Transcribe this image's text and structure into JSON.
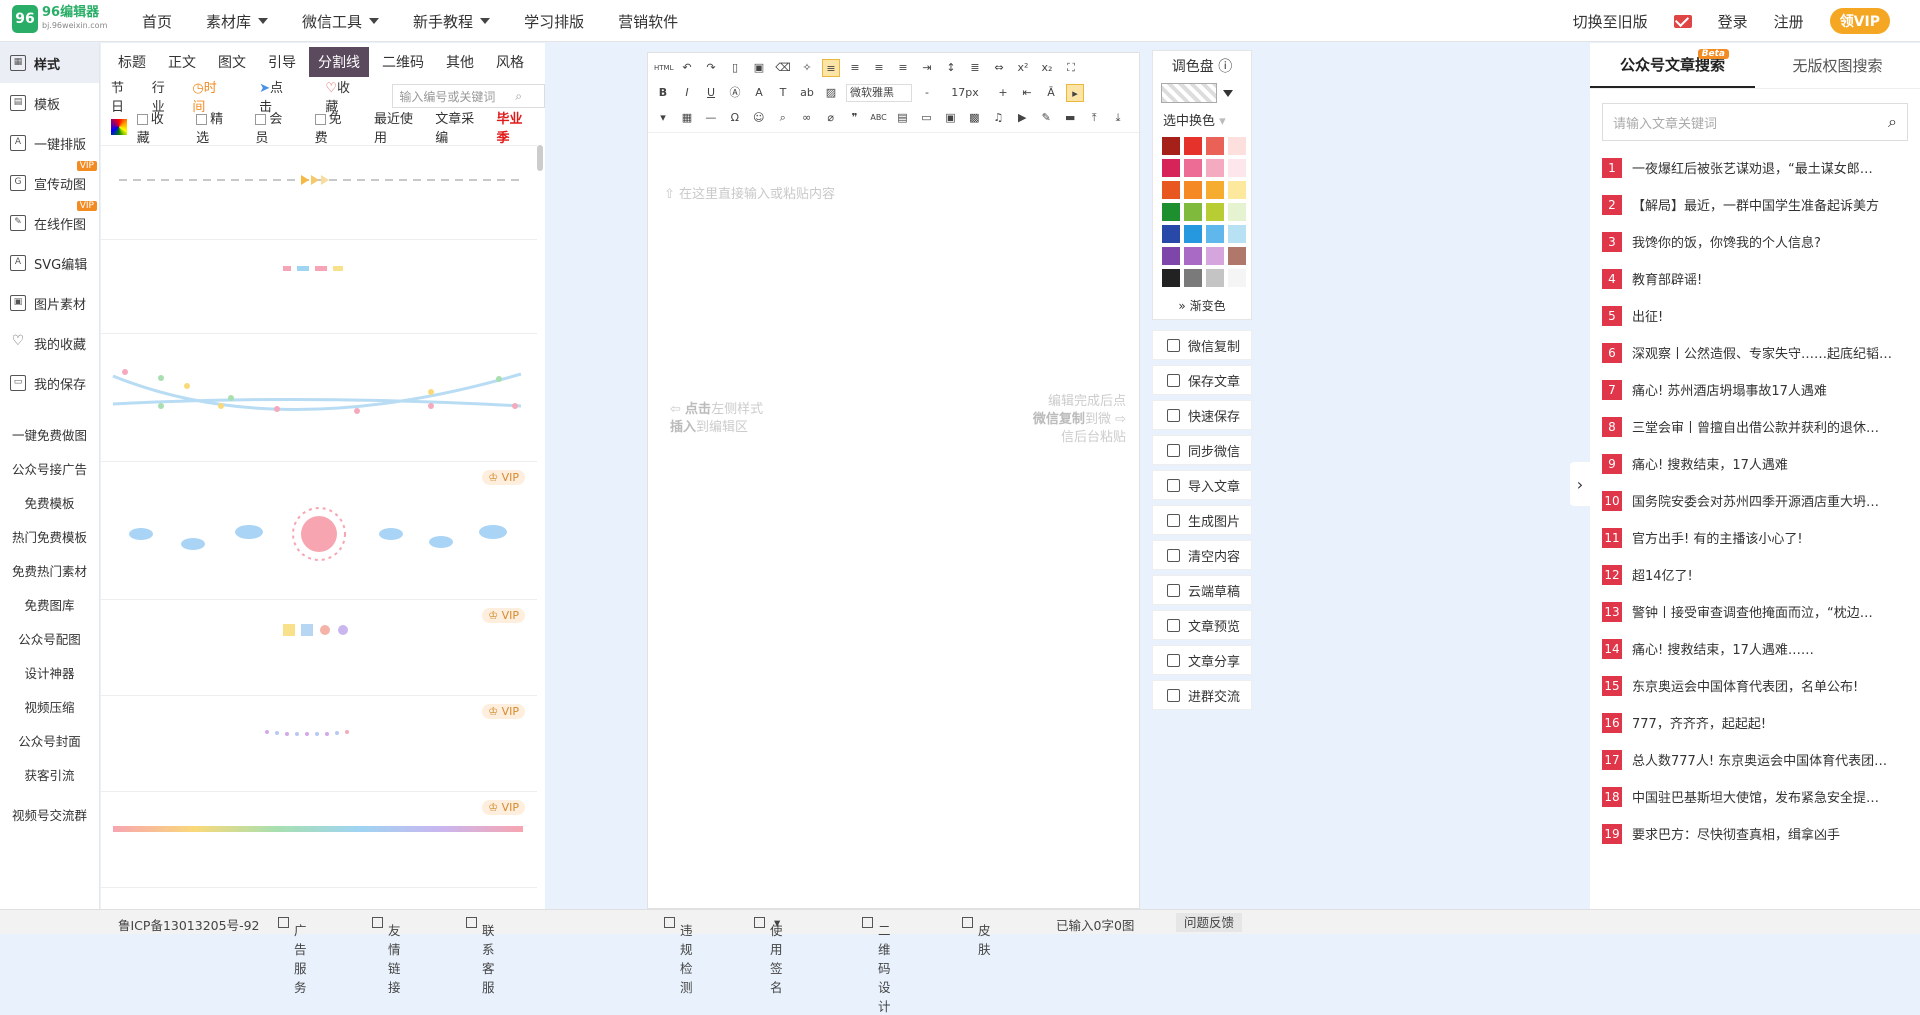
{
  "brand": {
    "logo_mark": "96",
    "name": "96编辑器",
    "domain": "bj.96weixin.com"
  },
  "nav": {
    "items": [
      "首页",
      "素材库",
      "微信工具",
      "新手教程",
      "学习排版",
      "营销软件"
    ]
  },
  "top_right": {
    "old_version": "切换至旧版",
    "login": "登录",
    "register": "注册",
    "vip": "领VIP"
  },
  "left_nav": {
    "items": [
      {
        "label": "样式",
        "icon": "style-icon"
      },
      {
        "label": "模板",
        "icon": "template-icon"
      },
      {
        "label": "一键排版",
        "icon": "auto-layout-icon"
      },
      {
        "label": "宣传动图",
        "icon": "gif-icon",
        "badge": "VIP"
      },
      {
        "label": "在线作图",
        "icon": "draw-icon",
        "badge": "VIP"
      },
      {
        "label": "SVG编辑",
        "icon": "svg-icon"
      },
      {
        "label": "图片素材",
        "icon": "image-icon"
      },
      {
        "label": "我的收藏",
        "icon": "heart-icon"
      },
      {
        "label": "我的保存",
        "icon": "save-icon"
      }
    ],
    "links": [
      "一键免费做图",
      "公众号接广告",
      "免费模板",
      "热门免费模板",
      "免费热门素材",
      "免费图库",
      "公众号配图",
      "设计神器",
      "视频压缩",
      "公众号封面",
      "获客引流",
      "视频号交流群"
    ]
  },
  "style_panel": {
    "tabs": [
      "标题",
      "正文",
      "图文",
      "引导",
      "分割线",
      "二维码",
      "其他",
      "风格"
    ],
    "active_tab": "分割线",
    "sub_tabs": [
      "节日",
      "行业"
    ],
    "sort_time": "时间",
    "sort_click": "点击",
    "sort_fav": "收藏",
    "search_placeholder": "输入编号或关键词",
    "filters": [
      "收藏",
      "精选",
      "会员",
      "免费"
    ],
    "recent": "最近使用",
    "collect": "文章采编",
    "season": "毕业季",
    "vip_label": "VIP"
  },
  "editor": {
    "placeholder": "在这里直接输入或粘贴内容",
    "font": "微软雅黑",
    "font_size": "17px",
    "hint_left_1": "点击",
    "hint_left_2": "左侧样式",
    "hint_left_3": "插入",
    "hint_left_4": "到编辑区",
    "hint_right_1": "编辑完成后点",
    "hint_right_2": "微信复制",
    "hint_right_3": "到微",
    "hint_right_4": "信后台粘贴"
  },
  "color_panel": {
    "title": "调色盘",
    "sub": "选中换色",
    "gradient": "渐变色",
    "swatches": [
      "#a52019",
      "#e5322b",
      "#ea6158",
      "#fde0dd",
      "#d6245a",
      "#ec6c95",
      "#f4aac0",
      "#fde7ec",
      "#e8571f",
      "#f58a25",
      "#f5ac2f",
      "#fde99e",
      "#1e8f2f",
      "#7fba3c",
      "#b8cd33",
      "#e6f3d0",
      "#2849a8",
      "#2598e0",
      "#5fb7ec",
      "#b8e2f4",
      "#7d46a8",
      "#a96ac5",
      "#d4a6dd",
      "#b0786a",
      "#222222",
      "#7a7a7a",
      "#c4c4c4",
      "#f5f5f5"
    ]
  },
  "actions": [
    {
      "label": "微信复制",
      "icon": "copy-icon"
    },
    {
      "label": "保存文章",
      "icon": "save-icon"
    },
    {
      "label": "快速保存",
      "icon": "flash-icon"
    },
    {
      "label": "同步微信",
      "icon": "sync-icon"
    },
    {
      "label": "导入文章",
      "icon": "import-icon"
    },
    {
      "label": "生成图片",
      "icon": "picture-icon"
    },
    {
      "label": "清空内容",
      "icon": "trash-icon"
    },
    {
      "label": "云端草稿",
      "icon": "cloud-icon"
    },
    {
      "label": "文章预览",
      "icon": "eye-icon"
    },
    {
      "label": "文章分享",
      "icon": "share-icon"
    },
    {
      "label": "进群交流",
      "icon": "group-icon"
    }
  ],
  "right_panel": {
    "tab_active": "公众号文章搜索",
    "beta": "Beta",
    "tab_other": "无版权图搜索",
    "search_placeholder": "请输入文章关键词",
    "news": [
      "一夜爆红后被张艺谋劝退，“最土谋女郎…",
      "【解局】最近，一群中国学生准备起诉美方",
      "我馋你的饭，你馋我的个人信息?",
      "教育部辟谣!",
      "出征!",
      "深观察丨公然造假、专家失守……起底纪韬…",
      "痛心! 苏州酒店坍塌事故17人遇难",
      "三堂会审丨曾擅自出借公款并获利的退休…",
      "痛心! 搜救结束，17人遇难",
      "国务院安委会对苏州四季开源酒店重大坍…",
      "官方出手! 有的主播该小心了!",
      "超14亿了!",
      "警钟丨接受审查调查他掩面而泣，“枕边…",
      "痛心! 搜救结束，17人遇难……",
      "东京奥运会中国体育代表团，名单公布!",
      "777，齐齐齐，起起起!",
      "总人数777人! 东京奥运会中国体育代表团…",
      "中国驻巴基斯坦大使馆，发布紧急安全提…",
      "要求巴方：尽快彻查真相，缉拿凶手"
    ]
  },
  "footer": {
    "icp": "鲁ICP备13013205号-92",
    "ad": "广告服务",
    "links": "友情链接",
    "service": "联系客服",
    "check": "违规检测",
    "sign": "使用签名",
    "qrcode": "二维码设计",
    "skin": "皮肤",
    "count": "已输入0字0图",
    "feedback": "问题反馈"
  }
}
